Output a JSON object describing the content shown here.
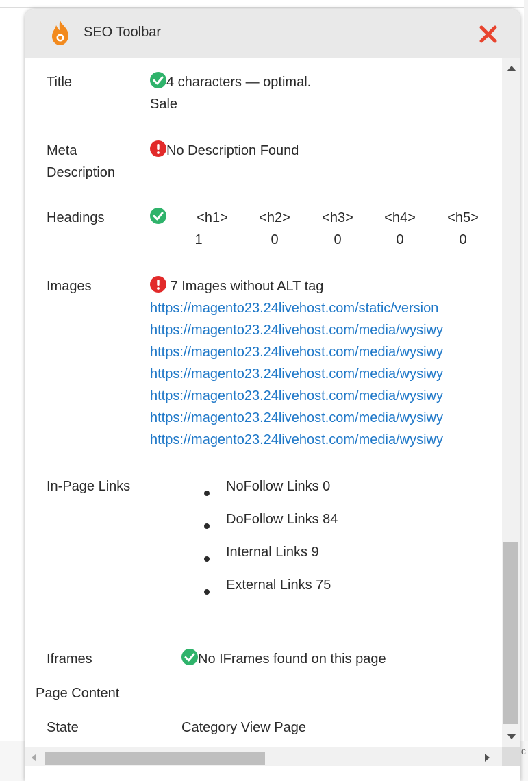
{
  "header": {
    "title": "SEO Toolbar"
  },
  "title_row": {
    "label": "Title",
    "status": "ok",
    "text": "4 characters — optimal.",
    "value": "Sale"
  },
  "meta_row": {
    "label_line1": "Meta",
    "label_line2": "Description",
    "status": "error",
    "text": "No Description Found"
  },
  "headings_row": {
    "label": "Headings",
    "status": "ok",
    "columns": [
      {
        "tag": "<h1>",
        "count": "1"
      },
      {
        "tag": "<h2>",
        "count": "0"
      },
      {
        "tag": "<h3>",
        "count": "0"
      },
      {
        "tag": "<h4>",
        "count": "0"
      },
      {
        "tag": "<h5>",
        "count": "0"
      }
    ]
  },
  "images_row": {
    "label": "Images",
    "status": "error",
    "text": "7 Images without ALT tag",
    "links": [
      "https://magento23.24livehost.com/static/version",
      "https://magento23.24livehost.com/media/wysiwy",
      "https://magento23.24livehost.com/media/wysiwy",
      "https://magento23.24livehost.com/media/wysiwy",
      "https://magento23.24livehost.com/media/wysiwy",
      "https://magento23.24livehost.com/media/wysiwy",
      "https://magento23.24livehost.com/media/wysiwy"
    ]
  },
  "links_row": {
    "label": "In-Page Links",
    "items": [
      "NoFollow Links 0",
      "DoFollow Links 84",
      "Internal Links 9",
      "External Links 75"
    ]
  },
  "iframes_row": {
    "label": "Iframes",
    "status": "ok",
    "text": "No IFrames found on this page"
  },
  "page_content": {
    "heading": "Page Content"
  },
  "state_row": {
    "label": "State",
    "value": "Category View Page"
  },
  "background": {
    "partial_text": "ıc"
  },
  "colors": {
    "ok": "#2fb36b",
    "error": "#e22a2a",
    "link": "#1f78c8",
    "close": "#e8442e",
    "logo": "#f28a1e"
  },
  "icons": {
    "logo": "flame-logo-icon",
    "close": "close-icon",
    "ok": "check-circle-icon",
    "error": "exclamation-circle-icon"
  }
}
